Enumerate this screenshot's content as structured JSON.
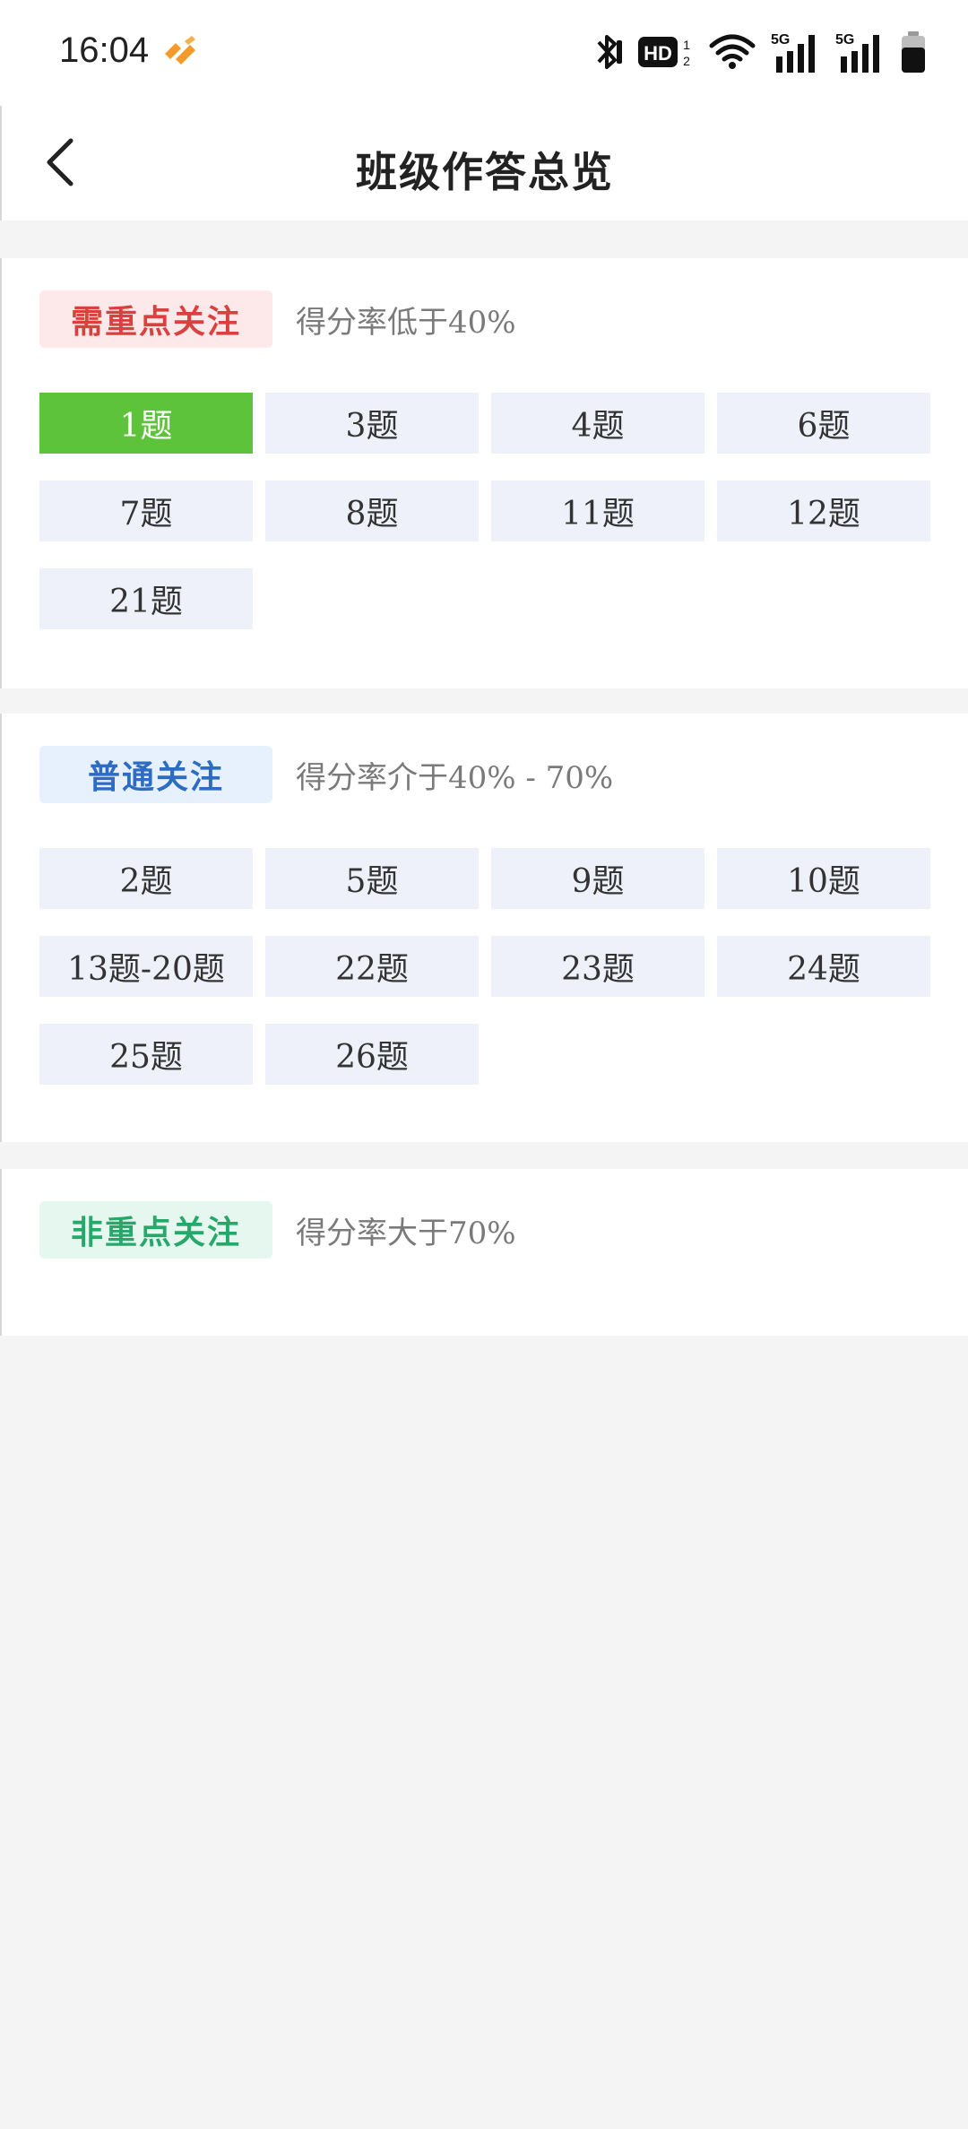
{
  "status_bar": {
    "time": "16:04",
    "icons": [
      "app-badge-icon",
      "bluetooth-icon",
      "hd-icon",
      "wifi-icon",
      "5g-signal-icon",
      "5g-signal-icon",
      "battery-icon"
    ],
    "hd_label": "HD",
    "network_label_1": "5G",
    "network_label_2": "5G"
  },
  "nav": {
    "back_icon": "chevron-left-icon",
    "title": "班级作答总览"
  },
  "sections": [
    {
      "tag": "需重点关注",
      "description": "得分率低于40%",
      "color": "#d9413f",
      "questions": [
        {
          "label": "1题",
          "active": true
        },
        {
          "label": "3题"
        },
        {
          "label": "4题"
        },
        {
          "label": "6题"
        },
        {
          "label": "7题"
        },
        {
          "label": "8题"
        },
        {
          "label": "11题"
        },
        {
          "label": "12题"
        },
        {
          "label": "21题"
        }
      ]
    },
    {
      "tag": "普通关注",
      "description": "得分率介于40% - 70%",
      "color": "#2d6cc4",
      "questions": [
        {
          "label": "2题"
        },
        {
          "label": "5题"
        },
        {
          "label": "9题"
        },
        {
          "label": "10题"
        },
        {
          "label": "13题-20题"
        },
        {
          "label": "22题"
        },
        {
          "label": "23题"
        },
        {
          "label": "24题"
        },
        {
          "label": "25题"
        },
        {
          "label": "26题"
        }
      ]
    },
    {
      "tag": "非重点关注",
      "description": "得分率大于70%",
      "color": "#27a86b",
      "questions": []
    }
  ],
  "colors": {
    "active_question": "#5cc33a",
    "question_bg": "#eef1fa",
    "page_bg": "#f4f4f5"
  }
}
